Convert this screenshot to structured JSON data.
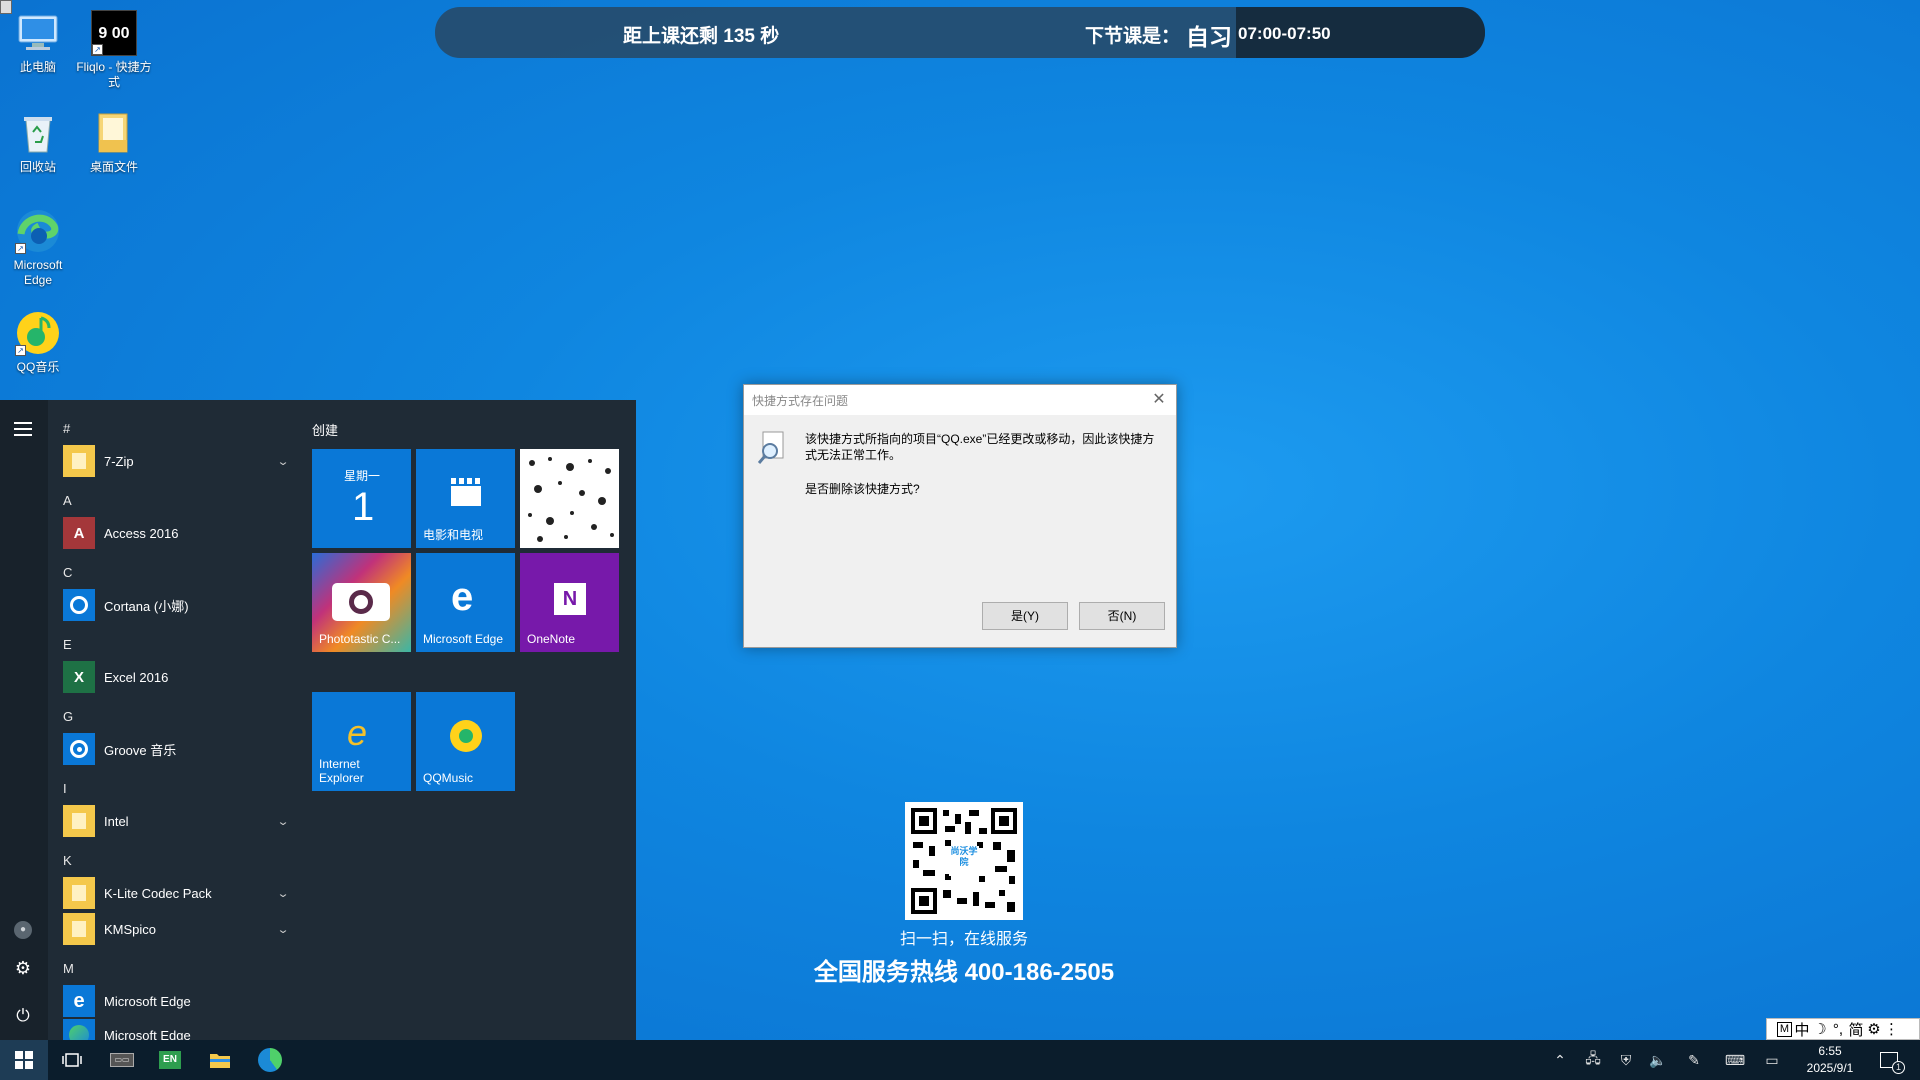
{
  "desktop": {
    "icons": [
      {
        "label": "此电脑"
      },
      {
        "label": "Fliqlo - 快捷方式",
        "thumb": "9 00"
      },
      {
        "label": "回收站"
      },
      {
        "label": "桌面文件"
      },
      {
        "label": "Microsoft Edge"
      },
      {
        "label": "QQ音乐"
      }
    ]
  },
  "topbar": {
    "countdown": "距上课还剩 135 秒",
    "next_label": "下节课是：",
    "next_subject": "自习",
    "time": "07:00-07:50"
  },
  "start_menu": {
    "groups": [
      {
        "letter": "#",
        "apps": [
          {
            "name": "7-Zip",
            "icon": "folder-icon",
            "expand": true
          }
        ]
      },
      {
        "letter": "A",
        "apps": [
          {
            "name": "Access 2016",
            "icon": "access-icon",
            "expand": false
          }
        ]
      },
      {
        "letter": "C",
        "apps": [
          {
            "name": "Cortana (小娜)",
            "icon": "cortana-icon",
            "expand": false
          }
        ]
      },
      {
        "letter": "E",
        "apps": [
          {
            "name": "Excel 2016",
            "icon": "excel-icon",
            "expand": false
          }
        ]
      },
      {
        "letter": "G",
        "apps": [
          {
            "name": "Groove 音乐",
            "icon": "groove-icon",
            "expand": false
          }
        ]
      },
      {
        "letter": "I",
        "apps": [
          {
            "name": "Intel",
            "icon": "folder-icon",
            "expand": true
          }
        ]
      },
      {
        "letter": "K",
        "apps": [
          {
            "name": "K-Lite Codec Pack",
            "icon": "folder-icon",
            "expand": true
          },
          {
            "name": "KMSpico",
            "icon": "folder-icon",
            "expand": true
          }
        ]
      },
      {
        "letter": "M",
        "apps": [
          {
            "name": "Microsoft Edge",
            "icon": "edge-legacy-icon",
            "expand": false
          },
          {
            "name": "Microsoft Edge",
            "icon": "edge-icon",
            "expand": false
          }
        ]
      }
    ],
    "tiles_header": "创建",
    "calendar_weekday": "星期一",
    "calendar_day": "1",
    "tiles": [
      {
        "label": "电影和电视"
      },
      {
        "label": "Phototastic C..."
      },
      {
        "label": "Microsoft Edge"
      },
      {
        "label": "OneNote"
      },
      {
        "label": "Internet Explorer"
      },
      {
        "label": "QQMusic"
      }
    ]
  },
  "dialog": {
    "title": "快捷方式存在问题",
    "message_line1": "该快捷方式所指向的项目“QQ.exe”已经更改或移动，因此该快捷方",
    "message_line2": "式无法正常工作。",
    "question": "是否删除该快捷方式?",
    "yes_label": "是(Y)",
    "no_label": "否(N)"
  },
  "promo": {
    "qr_caption": "扫一扫，在线服务",
    "hotline": "全国服务热线 400-186-2505",
    "qr_center": "尚沃学院"
  },
  "ime": {
    "mode": "中",
    "charset": "简"
  },
  "taskbar": {
    "clock_time": "6:55",
    "clock_date": "2025/9/1",
    "notification_count": "1",
    "lang_badge": "EN"
  }
}
